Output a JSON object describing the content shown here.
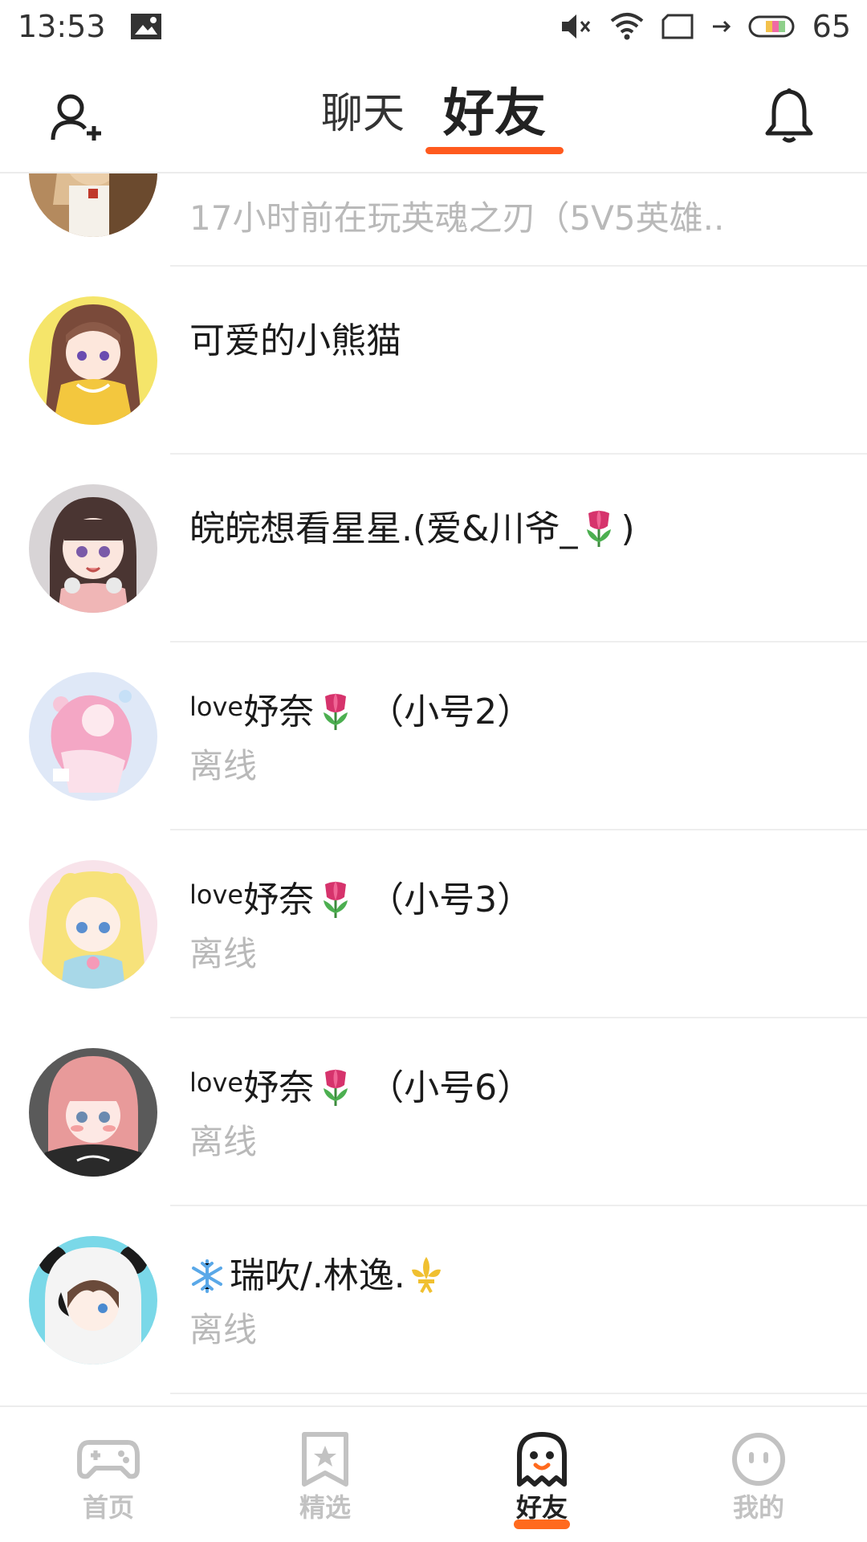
{
  "status_bar": {
    "time": "13:53",
    "battery": "65"
  },
  "header": {
    "tabs": [
      {
        "label": "聊天",
        "active": false
      },
      {
        "label": "好友",
        "active": true
      }
    ],
    "accent_color": "#ff5a1e"
  },
  "friends": [
    {
      "name": "",
      "status": "17小时前在玩英魂之刃（5V5英雄.."
    },
    {
      "name": "可爱的小熊猫",
      "status": ""
    },
    {
      "name": "皖皖想看星星.(爱&川爷_",
      "name_suffix": ")",
      "status": ""
    },
    {
      "name_prefix": "love",
      "name": "妤奈",
      "name_suffix": " （小号2）",
      "status": "离线"
    },
    {
      "name_prefix": "love",
      "name": "妤奈",
      "name_suffix": " （小号3）",
      "status": "离线"
    },
    {
      "name_prefix": "love",
      "name": "妤奈",
      "name_suffix": " （小号6）",
      "status": "离线"
    },
    {
      "name": "瑞吹/.林逸.",
      "status": "离线"
    }
  ],
  "bottom_nav": [
    {
      "label": "首页",
      "icon": "gamepad-icon",
      "active": false
    },
    {
      "label": "精选",
      "icon": "star-bookmark-icon",
      "active": false
    },
    {
      "label": "好友",
      "icon": "ghost-icon",
      "active": true
    },
    {
      "label": "我的",
      "icon": "face-icon",
      "active": false
    }
  ]
}
